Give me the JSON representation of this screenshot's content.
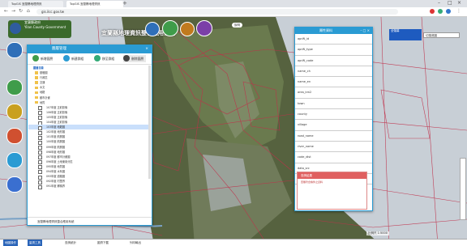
{
  "browser": {
    "tabs": [
      "TopGIS 宜蘭縣地理資訊",
      "TopGIS 宜蘭縣地理資訊"
    ],
    "url": "gis.ilcc.gov.tw"
  },
  "app": {
    "title": "宜蘭縣地理資訊整合應用系統",
    "logo_line1": "宜蘭縣政府",
    "logo_line2": "Yilan County Government"
  },
  "layer_panel": {
    "title": "圖層管理",
    "tools": [
      "新增圖層",
      "新建群組",
      "移至群組",
      "刪除圖層"
    ],
    "root": "圖層目錄",
    "groups": [
      "基礎圖",
      "行政區",
      "交通",
      "水文",
      "地籍",
      "都市計畫",
      "地質"
    ],
    "layers": [
      "107年度  正射影像",
      "106年度  正射影像",
      "105年度  正射影像",
      "104年度  正射影像",
      "103年度  地籍圖",
      "102年度  地形圖",
      "101年度  航照圖",
      "100年度  航照圖",
      "099年度  航照圖",
      "098年度  地形圖",
      "097年度  都市計畫圖",
      "096年度  土地使用分區",
      "095年度  地質圖",
      "094年度  水系圖",
      "093年度  道路圖",
      "092年度  村里界",
      "091年度  鄉鎮界"
    ],
    "selected_index": 4,
    "footer": "宜蘭縣地理資訊整合應用系統"
  },
  "attr_panel": {
    "title": "屬性資料",
    "rows": [
      "aprW_id",
      "aprW_type",
      "aprW_code",
      "name_ch",
      "name_en",
      "area_km2",
      "town",
      "county",
      "village",
      "road_name",
      "river_name",
      "code_dist",
      "data_src",
      "note"
    ]
  },
  "result_panel": {
    "title": "查詢結果",
    "text": "查無符合條件之資料"
  },
  "top_right": {
    "button": "全螢幕",
    "select": "切換底圖"
  },
  "bottom": {
    "items": [
      "地圖操作",
      "量測工具",
      "查詢統計",
      "圖資下載",
      "列印輸出"
    ]
  },
  "scale_text": "比例尺 1:5000",
  "colors": {
    "accent": "#2a9bd3",
    "boundary": "#c0304a"
  }
}
